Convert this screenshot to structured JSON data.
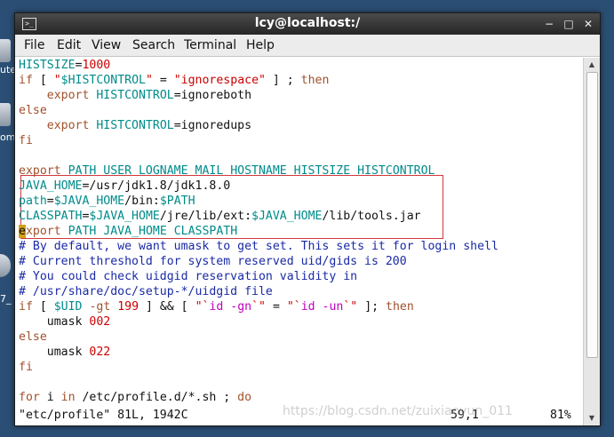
{
  "window": {
    "title": "lcy@localhost:/",
    "app_icon": "terminal-icon",
    "controls": [
      "minimize-icon",
      "maximize-icon",
      "close-icon"
    ]
  },
  "desktop": {
    "labels": [
      "ute",
      "om",
      "7_"
    ]
  },
  "menu": [
    "File",
    "Edit",
    "View",
    "Search",
    "Terminal",
    "Help"
  ],
  "editor": {
    "lines": [
      [
        {
          "t": "HISTSIZE",
          "c": "var"
        },
        {
          "t": "="
        },
        {
          "t": "1000",
          "c": "num"
        }
      ],
      [
        {
          "t": "if",
          "c": "kw"
        },
        {
          "t": " [ "
        },
        {
          "t": "\"",
          "c": "str"
        },
        {
          "t": "$HISTCONTROL",
          "c": "var"
        },
        {
          "t": "\"",
          "c": "str"
        },
        {
          "t": " = "
        },
        {
          "t": "\"ignorespace\"",
          "c": "str"
        },
        {
          "t": " ] ; "
        },
        {
          "t": "then",
          "c": "kw"
        }
      ],
      [
        {
          "t": "    "
        },
        {
          "t": "export",
          "c": "kw"
        },
        {
          "t": " "
        },
        {
          "t": "HISTCONTROL",
          "c": "var"
        },
        {
          "t": "=ignoreboth"
        }
      ],
      [
        {
          "t": "else",
          "c": "kw"
        }
      ],
      [
        {
          "t": "    "
        },
        {
          "t": "export",
          "c": "kw"
        },
        {
          "t": " "
        },
        {
          "t": "HISTCONTROL",
          "c": "var"
        },
        {
          "t": "=ignoredups"
        }
      ],
      [
        {
          "t": "fi",
          "c": "kw"
        }
      ],
      [
        {
          "t": ""
        }
      ],
      [
        {
          "t": "export",
          "c": "kw"
        },
        {
          "t": " "
        },
        {
          "t": "PATH USER LOGNAME MAIL HOSTNAME HISTSIZE HISTCONTROL",
          "c": "var"
        }
      ],
      [
        {
          "t": "JAVA_HOME",
          "c": "var"
        },
        {
          "t": "=/usr/jdk1.8/jdk1.8.0"
        }
      ],
      [
        {
          "t": "path",
          "c": "var"
        },
        {
          "t": "="
        },
        {
          "t": "$JAVA_HOME",
          "c": "var"
        },
        {
          "t": "/bin:"
        },
        {
          "t": "$PATH",
          "c": "var"
        }
      ],
      [
        {
          "t": "CLASSPATH",
          "c": "var"
        },
        {
          "t": "="
        },
        {
          "t": "$JAVA_HOME",
          "c": "var"
        },
        {
          "t": "/jre/lib/ext:"
        },
        {
          "t": "$JAVA_HOME",
          "c": "var"
        },
        {
          "t": "/lib/tools.jar"
        }
      ],
      [
        {
          "t": "e",
          "c": "cursor"
        },
        {
          "t": "xport",
          "c": "kw"
        },
        {
          "t": " "
        },
        {
          "t": "PATH JAVA_HOME CLASSPATH",
          "c": "var"
        }
      ],
      [
        {
          "t": "# By default, we want umask to get set. This sets it for login shell",
          "c": "cmt"
        }
      ],
      [
        {
          "t": "# Current threshold for system reserved uid/gids is 200",
          "c": "cmt"
        }
      ],
      [
        {
          "t": "# You could check uidgid reservation validity in",
          "c": "cmt"
        }
      ],
      [
        {
          "t": "# /usr/share/doc/setup-*/uidgid file",
          "c": "cmt"
        }
      ],
      [
        {
          "t": "if",
          "c": "kw"
        },
        {
          "t": " [ "
        },
        {
          "t": "$UID",
          "c": "var"
        },
        {
          "t": " "
        },
        {
          "t": "-gt",
          "c": "kw"
        },
        {
          "t": " "
        },
        {
          "t": "199",
          "c": "num"
        },
        {
          "t": " ] && [ "
        },
        {
          "t": "\"`",
          "c": "str"
        },
        {
          "t": "id -gn",
          "c": "brk"
        },
        {
          "t": "`\"",
          "c": "str"
        },
        {
          "t": " = "
        },
        {
          "t": "\"`",
          "c": "str"
        },
        {
          "t": "id -un",
          "c": "brk"
        },
        {
          "t": "`\"",
          "c": "str"
        },
        {
          "t": " ]; "
        },
        {
          "t": "then",
          "c": "kw"
        }
      ],
      [
        {
          "t": "    umask "
        },
        {
          "t": "002",
          "c": "num"
        }
      ],
      [
        {
          "t": "else",
          "c": "kw"
        }
      ],
      [
        {
          "t": "    umask "
        },
        {
          "t": "022",
          "c": "num"
        }
      ],
      [
        {
          "t": "fi",
          "c": "kw"
        }
      ],
      [
        {
          "t": ""
        }
      ],
      [
        {
          "t": "for",
          "c": "kw"
        },
        {
          "t": " i "
        },
        {
          "t": "in",
          "c": "kw"
        },
        {
          "t": " /etc/profile.d/*.sh ; "
        },
        {
          "t": "do",
          "c": "kw"
        }
      ]
    ],
    "status_file": "\"etc/profile\" 81L, 1942C",
    "status_pos": "59,1",
    "status_pct": "81%"
  },
  "watermark": "https://blog.csdn.net/zuixiaoyun_011",
  "colors": {
    "keyword": "#a0522d",
    "variable": "#008b8b",
    "string": "#cc0000",
    "comment": "#1a2aa6",
    "highlight_border": "#d0383c",
    "titlebar": "#2e2e2e"
  }
}
